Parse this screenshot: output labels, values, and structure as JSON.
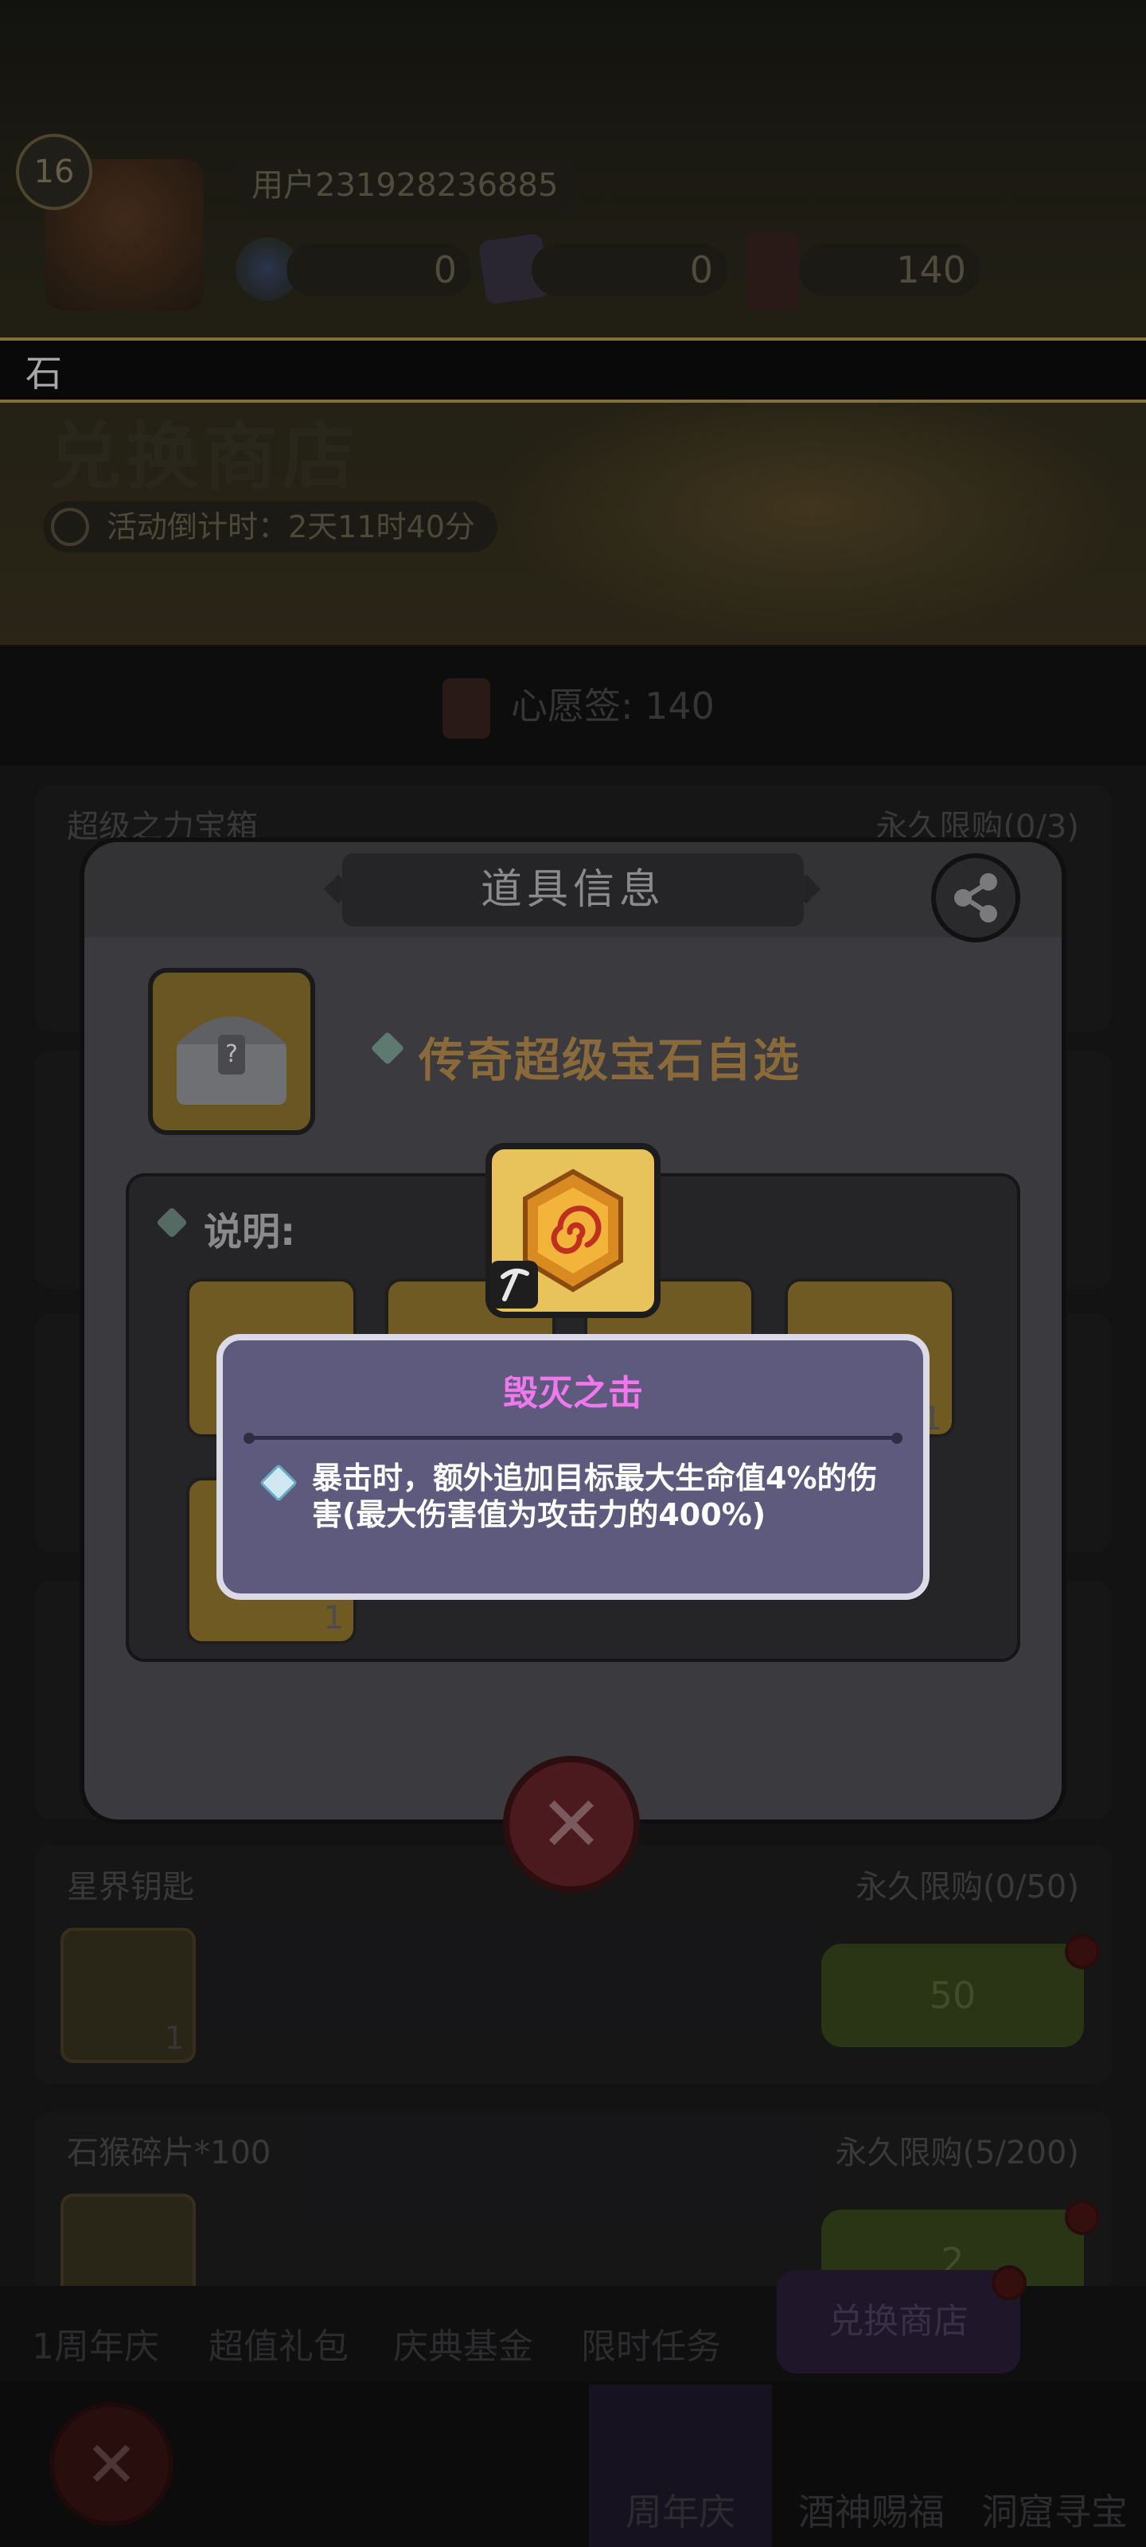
{
  "header": {
    "level": "16",
    "user_id": "用户231928236885",
    "currencies": [
      {
        "icon": "blue-coin-icon",
        "amount": "0"
      },
      {
        "icon": "purple-gem-icon",
        "amount": "0"
      },
      {
        "icon": "wish-ticket-icon",
        "amount": "140"
      }
    ],
    "banner_text": "石",
    "page_title": "兑换商店",
    "countdown": "活动倒计时：2天11时40分"
  },
  "wish_bar": {
    "label": "心愿签: 140"
  },
  "shop_items": [
    {
      "title": "超级之力宝箱",
      "limit": "永久限购(0/3)"
    },
    {
      "title": "星界钥匙",
      "limit": "永久限购(0/50)",
      "price": "50",
      "count": "1"
    },
    {
      "title": "石猴碎片*100",
      "limit": "永久限购(5/200)",
      "price": "2"
    }
  ],
  "event_tabs": [
    {
      "label": "1周年庆"
    },
    {
      "label": "超值礼包"
    },
    {
      "label": "庆典基金"
    },
    {
      "label": "限时任务"
    },
    {
      "label": "兑换商店",
      "active": true
    }
  ],
  "bottom_nav": [
    {
      "label": "周年庆",
      "active": true
    },
    {
      "label": "酒神赐福"
    },
    {
      "label": "洞窟寻宝"
    }
  ],
  "item_dialog": {
    "title": "道具信息",
    "item_name": "传奇超级宝石自选",
    "description_label": "说明:",
    "gem_counts": [
      "1",
      "1"
    ]
  },
  "skill_tooltip": {
    "title": "毁灭之击",
    "description": "暴击时，额外追加目标最大生命值4%的伤害(最大伤害值为攻击力的400%)"
  },
  "colors": {
    "tooltip_title": "#ee78ec",
    "tooltip_bg": "#5d5a7e",
    "tooltip_border": "#dcdae6",
    "gem_frame": "#e8c25a"
  }
}
